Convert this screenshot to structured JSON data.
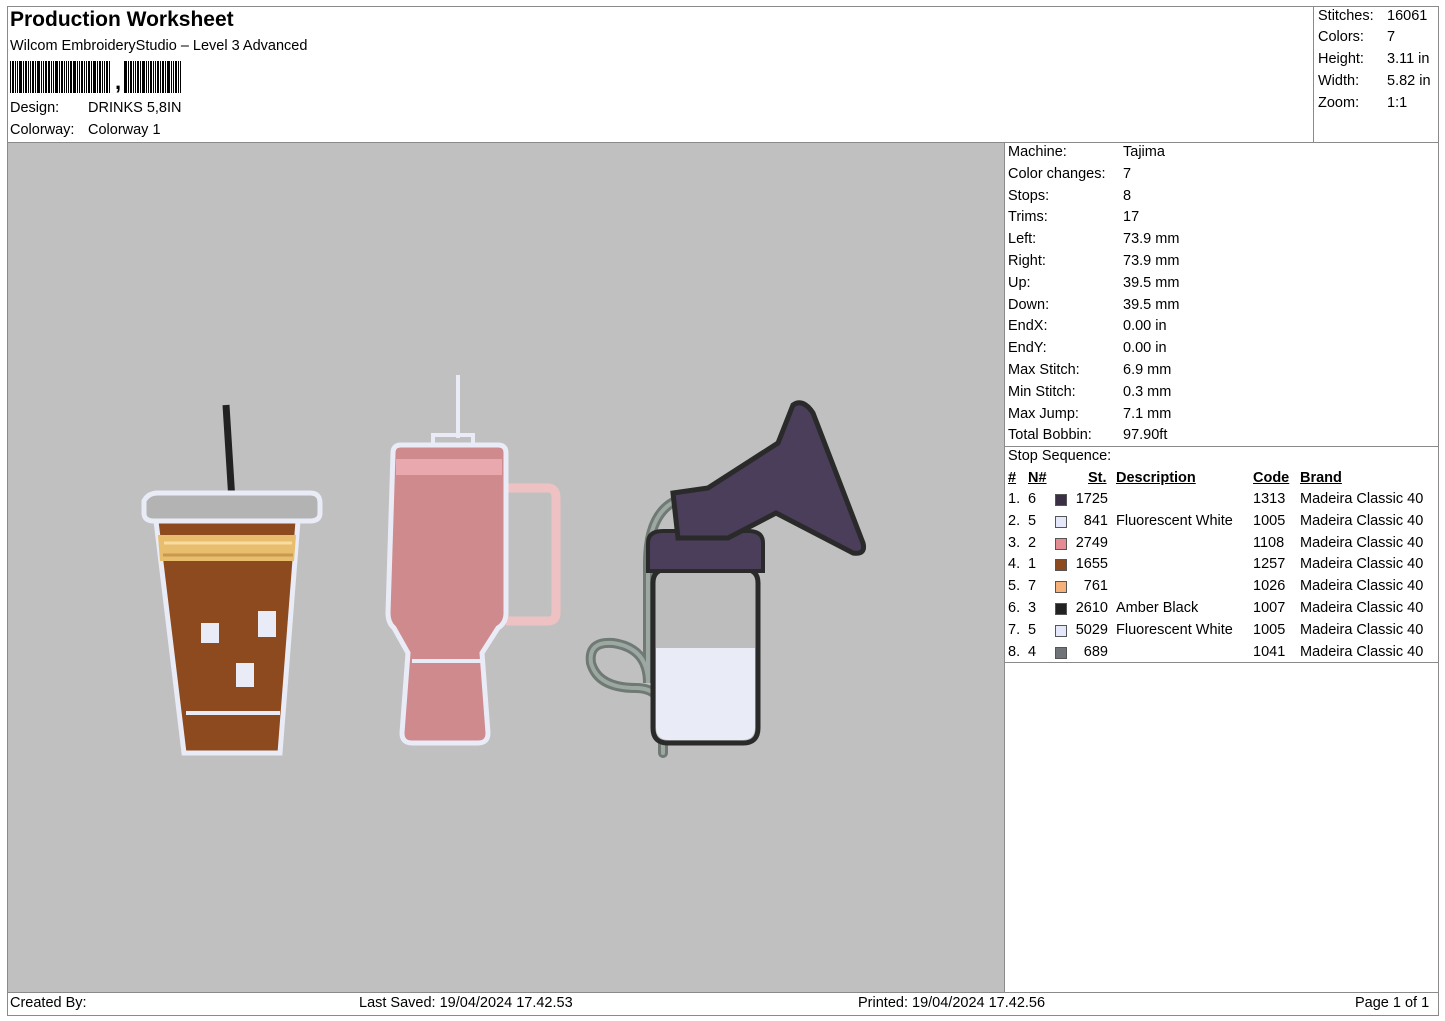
{
  "header": {
    "title": "Production Worksheet",
    "subtitle": "Wilcom EmbroideryStudio – Level 3 Advanced",
    "barcode_suffix": ",",
    "design_label": "Design:",
    "design_value": "DRINKS 5,8IN",
    "colorway_label": "Colorway:",
    "colorway_value": "Colorway 1"
  },
  "stats": [
    {
      "label": "Stitches:",
      "value": "16061"
    },
    {
      "label": "Colors:",
      "value": "7"
    },
    {
      "label": "Height:",
      "value": "3.11 in"
    },
    {
      "label": "Width:",
      "value": "5.82 in"
    },
    {
      "label": "Zoom:",
      "value": "1:1"
    }
  ],
  "machine": [
    {
      "label": "Machine:",
      "value": "Tajima"
    },
    {
      "label": "Color changes:",
      "value": "7"
    },
    {
      "label": "Stops:",
      "value": "8"
    },
    {
      "label": "Trims:",
      "value": "17"
    },
    {
      "label": "Left:",
      "value": "73.9 mm"
    },
    {
      "label": "Right:",
      "value": "73.9 mm"
    },
    {
      "label": "Up:",
      "value": "39.5 mm"
    },
    {
      "label": "Down:",
      "value": "39.5 mm"
    },
    {
      "label": "EndX:",
      "value": "0.00 in"
    },
    {
      "label": "EndY:",
      "value": "0.00 in"
    },
    {
      "label": "Max Stitch:",
      "value": "6.9 mm"
    },
    {
      "label": "Min Stitch:",
      "value": "0.3 mm"
    },
    {
      "label": "Max Jump:",
      "value": "7.1 mm"
    },
    {
      "label": "Total Bobbin:",
      "value": "97.90ft"
    }
  ],
  "stop_sequence": {
    "title": "Stop Sequence:",
    "headers": {
      "idx": "#",
      "n": "N#",
      "st": "St.",
      "desc": "Description",
      "code": "Code",
      "brand": "Brand"
    },
    "rows": [
      {
        "idx": "1.",
        "n": "6",
        "color": "#3b2f46",
        "st": "1725",
        "desc": "",
        "code": "1313",
        "brand": "Madeira Classic 40"
      },
      {
        "idx": "2.",
        "n": "5",
        "color": "#e4e8fa",
        "st": "841",
        "desc": "Fluorescent White",
        "code": "1005",
        "brand": "Madeira Classic 40"
      },
      {
        "idx": "3.",
        "n": "2",
        "color": "#e58b93",
        "st": "2749",
        "desc": "",
        "code": "1108",
        "brand": "Madeira Classic 40"
      },
      {
        "idx": "4.",
        "n": "1",
        "color": "#8e4a1f",
        "st": "1655",
        "desc": "",
        "code": "1257",
        "brand": "Madeira Classic 40"
      },
      {
        "idx": "5.",
        "n": "7",
        "color": "#f6b07a",
        "st": "761",
        "desc": "",
        "code": "1026",
        "brand": "Madeira Classic 40"
      },
      {
        "idx": "6.",
        "n": "3",
        "color": "#222222",
        "st": "2610",
        "desc": "Amber Black",
        "code": "1007",
        "brand": "Madeira Classic 40"
      },
      {
        "idx": "7.",
        "n": "5",
        "color": "#e4e8fa",
        "st": "5029",
        "desc": "Fluorescent White",
        "code": "1005",
        "brand": "Madeira Classic 40"
      },
      {
        "idx": "8.",
        "n": "4",
        "color": "#707478",
        "st": "689",
        "desc": "",
        "code": "1041",
        "brand": "Madeira Classic 40"
      }
    ]
  },
  "footer": {
    "created_by": "Created By:",
    "last_saved": "Last Saved: 19/04/2024 17.42.53",
    "printed": "Printed: 19/04/2024 17.42.56",
    "page": "Page 1 of 1"
  },
  "colors": {
    "canvas_bg": "#c0c0c0",
    "coffee": "#8e4a1f",
    "tumbler_pink": "#cf8a8e",
    "pump_purple": "#4a3e5a",
    "tube_gray": "#6f7a75"
  }
}
